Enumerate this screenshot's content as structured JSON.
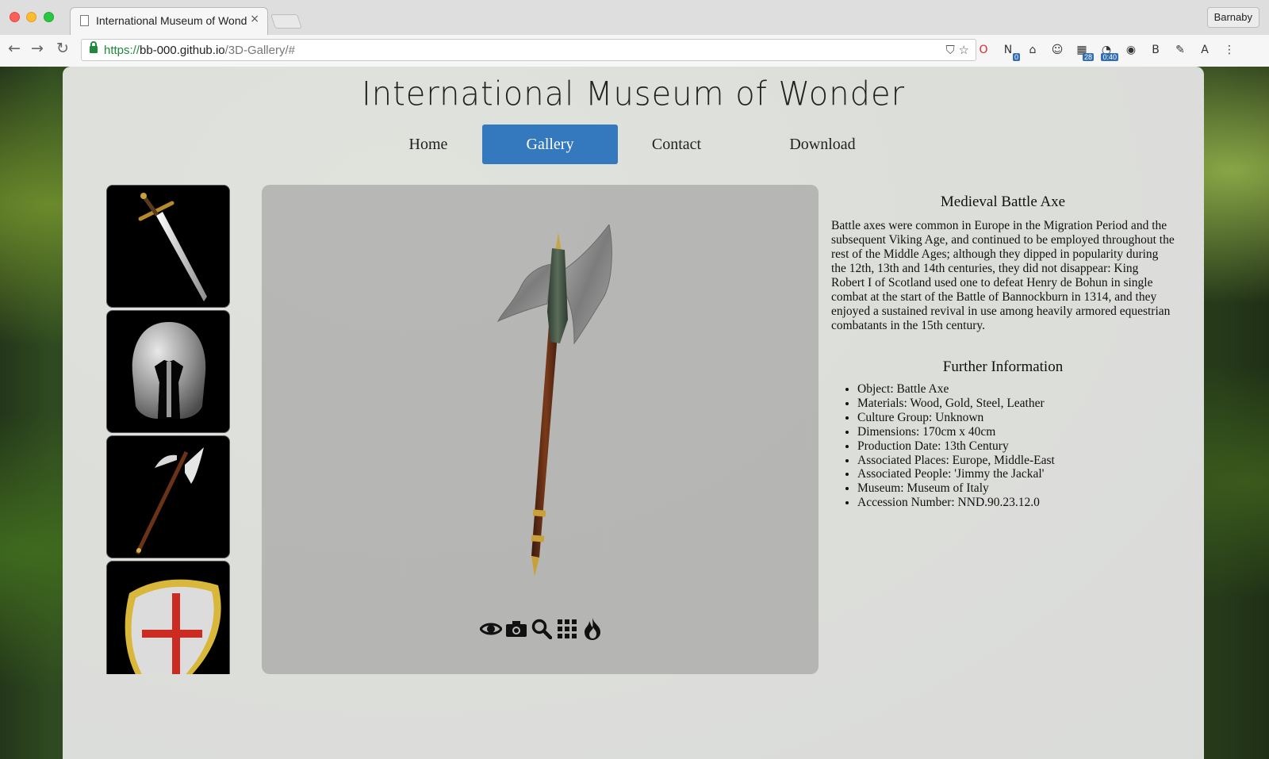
{
  "browser": {
    "tab_title": "International Museum of Wonder",
    "tab_close": "×",
    "url_scheme": "https://",
    "url_host": "bb-000.github.io",
    "url_path": "/3D-Gallery/#",
    "profile_name": "Barnaby",
    "nav_back": "←",
    "nav_forward": "→",
    "nav_reload": "↻",
    "extensions": [
      {
        "name": "opera-icon",
        "glyph": "O",
        "color": "#e0262b"
      },
      {
        "name": "onenote-icon",
        "glyph": "N",
        "badge": "0"
      },
      {
        "name": "ghost-icon",
        "glyph": "⌂"
      },
      {
        "name": "robot-icon",
        "glyph": "☺"
      },
      {
        "name": "calendar-icon",
        "glyph": "▦",
        "badge": "28"
      },
      {
        "name": "timer-icon",
        "glyph": "◔",
        "badge": "0:40"
      },
      {
        "name": "eye-ext-icon",
        "glyph": "◉"
      },
      {
        "name": "bold-b-icon",
        "glyph": "B"
      },
      {
        "name": "pipette-icon",
        "glyph": "✎"
      },
      {
        "name": "font-icon",
        "glyph": "A"
      },
      {
        "name": "menu-dots-icon",
        "glyph": "⋮"
      }
    ]
  },
  "site": {
    "title": "International Museum of Wonder",
    "nav": {
      "home": "Home",
      "gallery": "Gallery",
      "contact": "Contact",
      "download": "Download"
    },
    "active_nav": "gallery",
    "accent_color": "#3478bd"
  },
  "gallery": {
    "thumbnails": [
      {
        "name": "sword"
      },
      {
        "name": "helmet"
      },
      {
        "name": "battle-axe",
        "selected": true
      },
      {
        "name": "shield"
      }
    ],
    "tools": [
      "eye-icon",
      "camera-icon",
      "zoom-icon",
      "grid-icon",
      "fire-icon"
    ]
  },
  "artifact": {
    "title": "Medieval Battle Axe",
    "description": "Battle axes were common in Europe in the Migration Period and the subsequent Viking Age, and continued to be employed throughout the rest of the Middle Ages; although they dipped in popularity during the 12th, 13th and 14th centuries, they did not disappear: King Robert I of Scotland used one to defeat Henry de Bohun in single combat at the start of the Battle of Bannockburn in 1314, and they enjoyed a sustained revival in use among heavily armored equestrian combatants in the 15th century.",
    "further_heading": "Further Information",
    "facts": [
      "Object: Battle Axe",
      "Materials: Wood, Gold, Steel, Leather",
      "Culture Group: Unknown",
      "Dimensions: 170cm x 40cm",
      "Production Date: 13th Century",
      "Associated Places: Europe, Middle-East",
      "Associated People: 'Jimmy the Jackal'",
      "Museum: Museum of Italy",
      "Accession Number: NND.90.23.12.0"
    ]
  }
}
